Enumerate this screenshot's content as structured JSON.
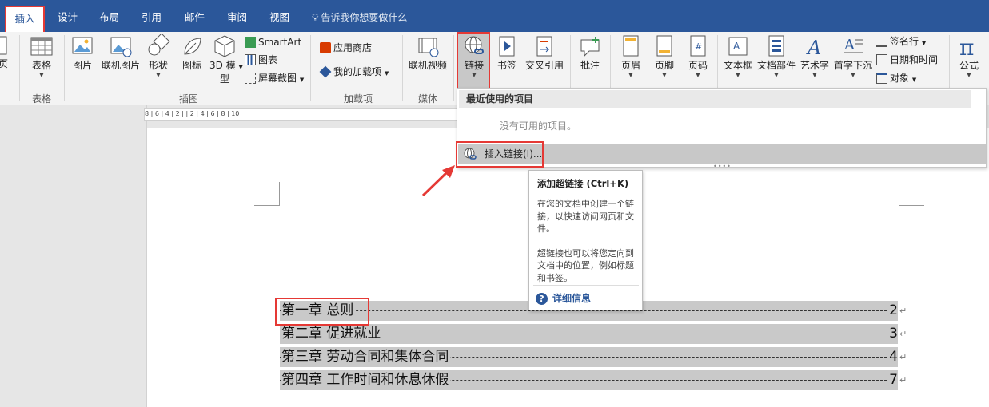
{
  "tabs": [
    {
      "label": "插入",
      "active": true
    },
    {
      "label": "设计"
    },
    {
      "label": "布局"
    },
    {
      "label": "引用"
    },
    {
      "label": "邮件"
    },
    {
      "label": "审阅"
    },
    {
      "label": "视图"
    }
  ],
  "tellme": "告诉我你想要做什么",
  "ribbon": {
    "page_fragment": "页",
    "table": "表格",
    "picture": "图片",
    "online_picture": "联机图片",
    "shapes": "形状",
    "icons": "图标",
    "model_3d": "3D 模",
    "model_3d_2": "型",
    "smartart": "SmartArt",
    "chart": "图表",
    "screenshot": "屏幕截图",
    "store": "应用商店",
    "my_addins": "我的加载项",
    "online_video": "联机视频",
    "link": "链接",
    "bookmark": "书签",
    "cross_ref": "交叉引用",
    "comment": "批注",
    "header": "页眉",
    "footer": "页脚",
    "page_number": "页码",
    "textbox": "文本框",
    "quick_parts": "文档部件",
    "wordart": "艺术字",
    "dropcap": "首字下沉",
    "signature_line": "签名行",
    "date_time": "日期和时间",
    "object": "对象",
    "equation": "公式",
    "groups": {
      "tables": "表格",
      "illustrations": "插图",
      "addins": "加载项",
      "media": "媒体"
    }
  },
  "ruler_text": "8 | 6 | 4 | 2 |    | 2 | 4 | 6 | 8 | 10",
  "dropdown": {
    "header": "最近使用的项目",
    "empty": "没有可用的项目。",
    "insert_link": "插入链接(I)..."
  },
  "tooltip": {
    "title": "添加超链接 (Ctrl+K)",
    "body1": "在您的文档中创建一个链接，以快速访问网页和文件。",
    "body2": "超链接也可以将您定向到文档中的位置，例如标题和书签。",
    "more": "详细信息"
  },
  "toc": [
    {
      "title": "第一章  总则",
      "page": "2"
    },
    {
      "title": "第二章  促进就业",
      "page": "3"
    },
    {
      "title": "第三章  劳动合同和集体合同",
      "page": "4"
    },
    {
      "title": "第四章  工作时间和休息休假",
      "page": "7"
    }
  ],
  "colors": {
    "ribbon_blue": "#2b579a",
    "highlight_red": "#e53935",
    "toc_bg": "#c9c9c9"
  }
}
